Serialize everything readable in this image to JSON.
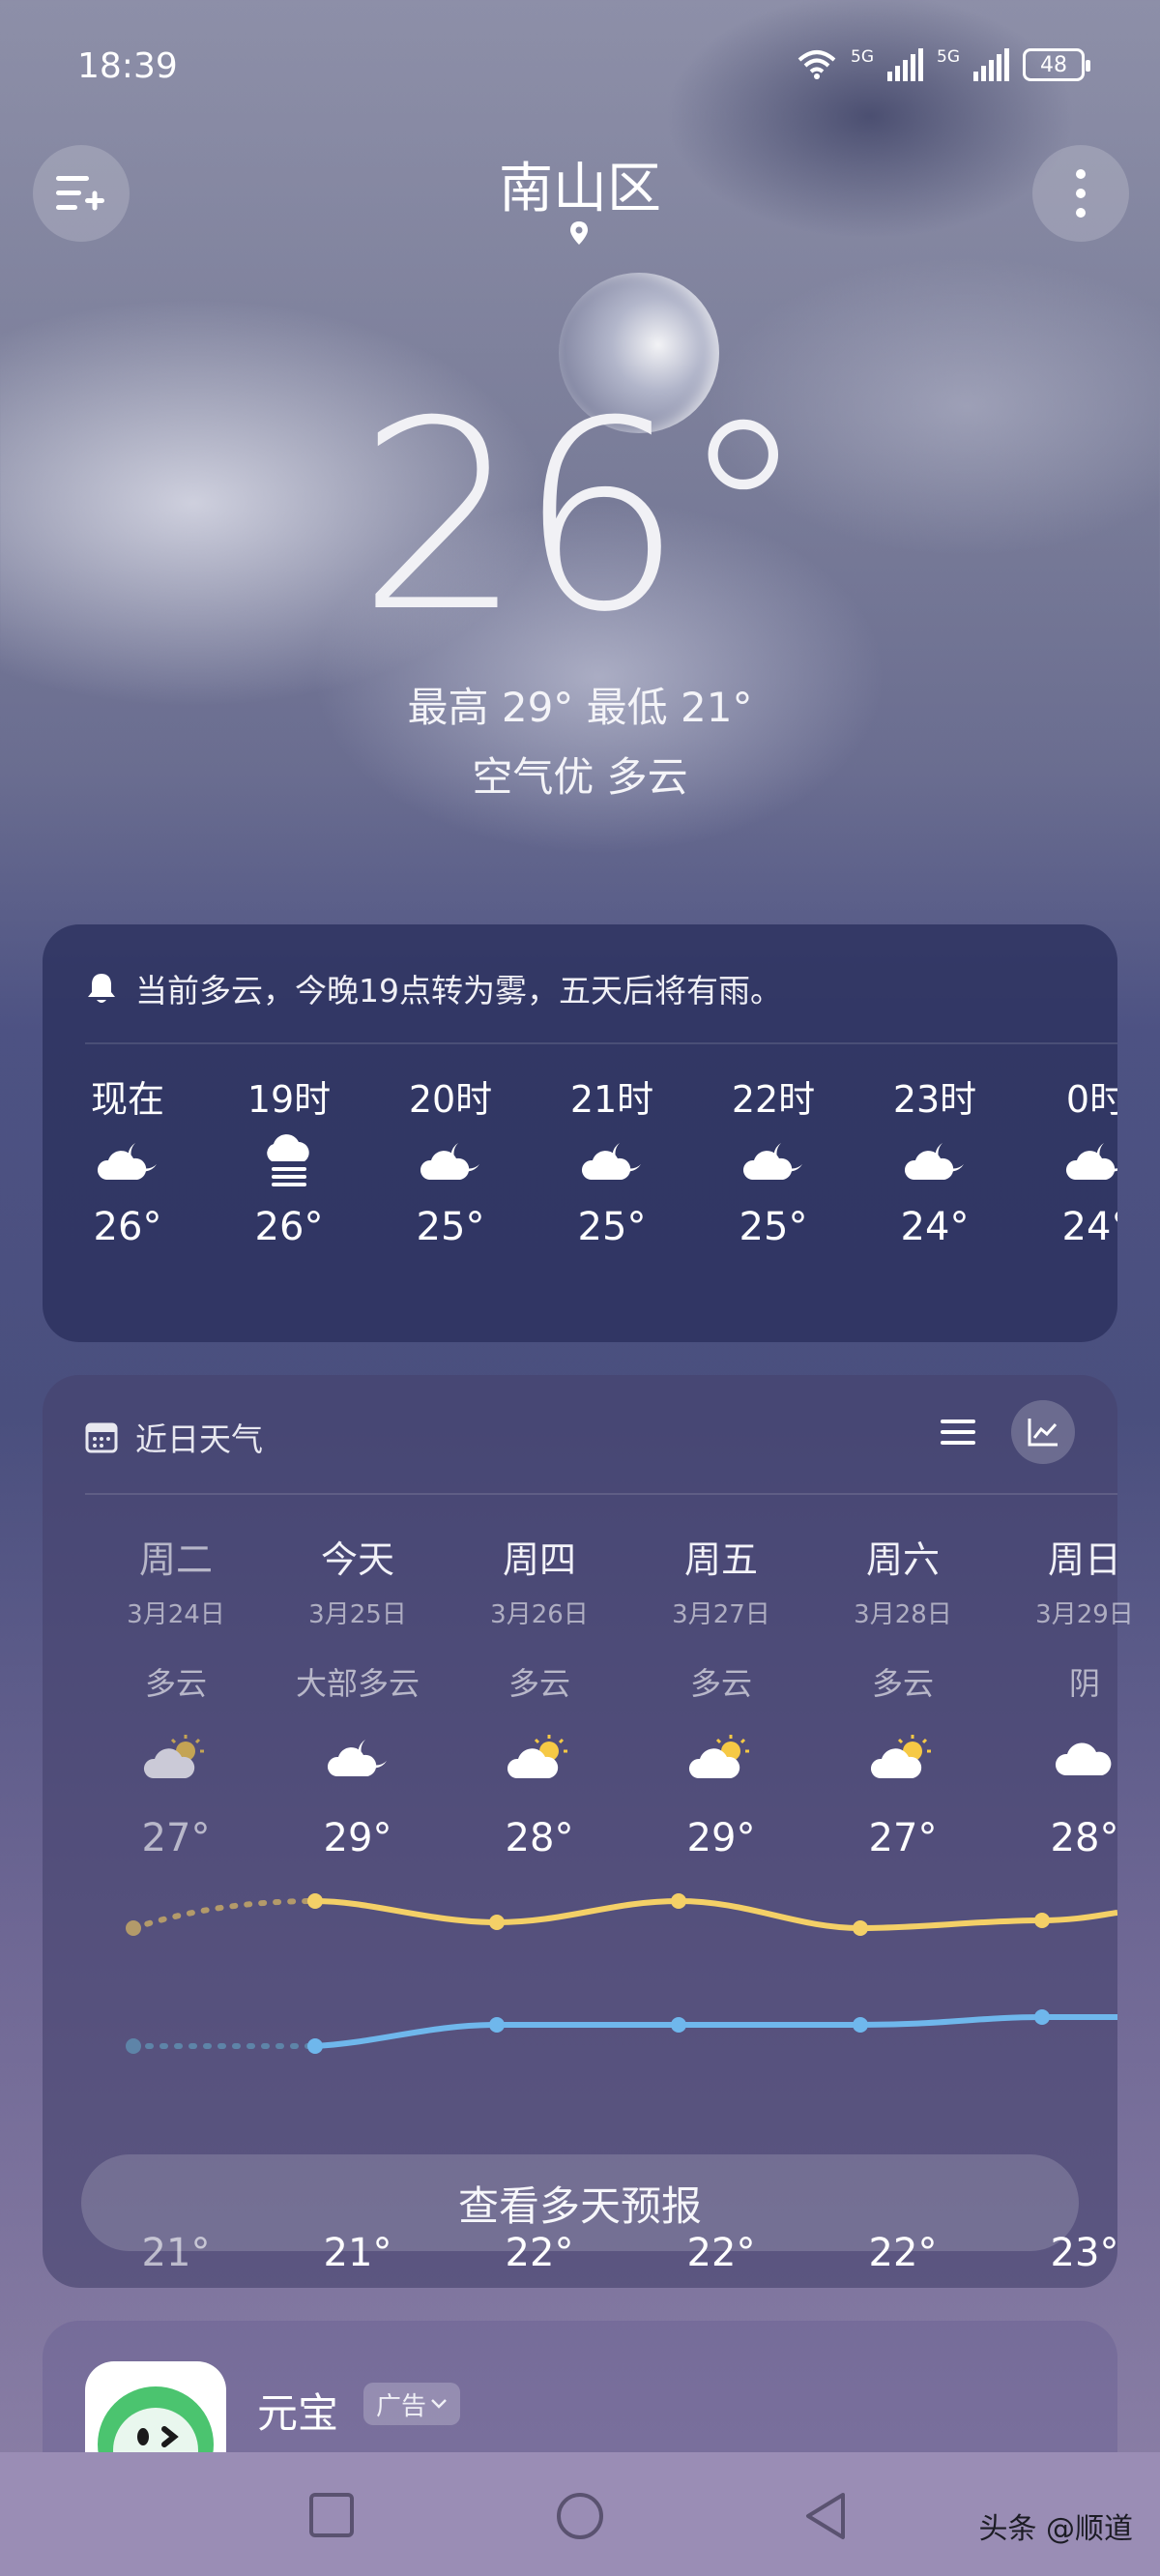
{
  "status": {
    "time": "18:39",
    "network1": "5G",
    "network2": "5G",
    "battery": "48"
  },
  "header": {
    "city": "南山区"
  },
  "current": {
    "temperature": "26°",
    "hilo": "最高 29° 最低 21°",
    "air_weather": "空气优  多云"
  },
  "alert": {
    "text": "当前多云，今晚19点转为雾，五天后将有雨。"
  },
  "hourly": [
    {
      "label": "现在",
      "icon": "cloud-moon-icon",
      "temp": "26°"
    },
    {
      "label": "19时",
      "icon": "fog-icon",
      "temp": "26°"
    },
    {
      "label": "20时",
      "icon": "cloud-moon-icon",
      "temp": "25°"
    },
    {
      "label": "21时",
      "icon": "cloud-moon-icon",
      "temp": "25°"
    },
    {
      "label": "22时",
      "icon": "cloud-moon-icon",
      "temp": "25°"
    },
    {
      "label": "23时",
      "icon": "cloud-moon-icon",
      "temp": "24°"
    },
    {
      "label": "0时",
      "icon": "cloud-moon-icon",
      "temp": "24°"
    }
  ],
  "daily": {
    "title": "近日天气",
    "days": [
      {
        "day": "周二",
        "date": "3月24日",
        "weather": "多云",
        "icon": "partly-cloudy-icon",
        "high": "27°",
        "low": "21°"
      },
      {
        "day": "今天",
        "date": "3月25日",
        "weather": "大部多云",
        "icon": "cloud-moon-icon",
        "high": "29°",
        "low": "21°"
      },
      {
        "day": "周四",
        "date": "3月26日",
        "weather": "多云",
        "icon": "partly-cloudy-icon",
        "high": "28°",
        "low": "22°"
      },
      {
        "day": "周五",
        "date": "3月27日",
        "weather": "多云",
        "icon": "partly-cloudy-icon",
        "high": "29°",
        "low": "22°"
      },
      {
        "day": "周六",
        "date": "3月28日",
        "weather": "多云",
        "icon": "partly-cloudy-icon",
        "high": "27°",
        "low": "22°"
      },
      {
        "day": "周日",
        "date": "3月29日",
        "weather": "阴",
        "icon": "cloud-icon",
        "high": "28°",
        "low": "23°"
      }
    ],
    "more_button": "查看多天预报"
  },
  "ad": {
    "app_name": "元宝",
    "tag": "广告"
  },
  "watermark": "头条 @顺道",
  "colors": {
    "high_line": "#f4d067",
    "low_line": "#6fb7ec",
    "sun": "#f6c945"
  }
}
